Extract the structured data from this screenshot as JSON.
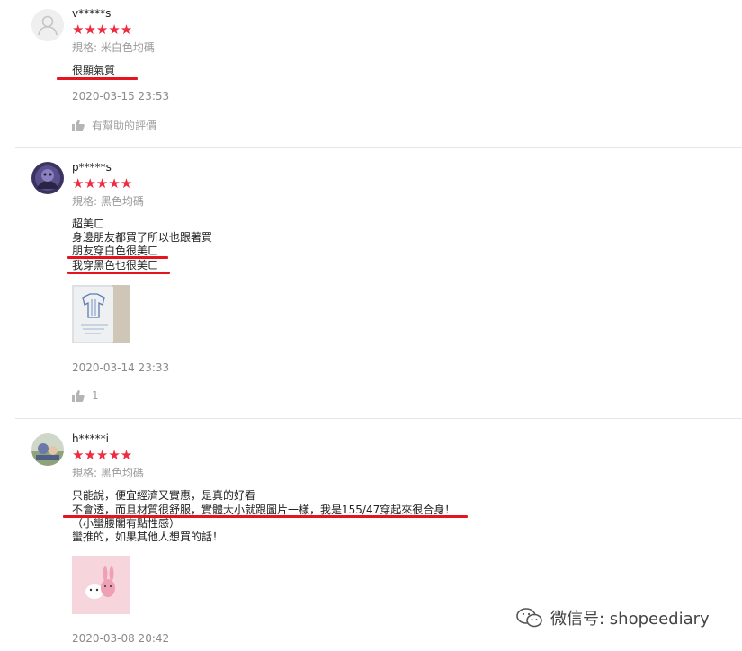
{
  "reviews": [
    {
      "username": "v*****s",
      "rating_stars": "★★★★★",
      "rating": 5,
      "variation": "規格: 米白色均碼",
      "text_lines": [
        "很顯氣質"
      ],
      "date": "2020-03-15 23:53",
      "helpful_label": "有幫助的評價",
      "avatar_icon": "default-user-avatar"
    },
    {
      "username": "p*****s",
      "rating_stars": "★★★★★",
      "rating": 5,
      "variation": "規格: 黑色均碼",
      "text_lines": [
        "超美ㄈ",
        "身邊朋友都買了所以也跟著買",
        "朋友穿白色很美ㄈ",
        "我穿黑色也很美ㄈ"
      ],
      "date": "2020-03-14 23:33",
      "helpful_count": "1"
    },
    {
      "username": "h*****i",
      "rating_stars": "★★★★★",
      "rating": 5,
      "variation": "規格: 黑色均碼",
      "text_lines": [
        "只能說，便宜經濟又實惠，是真的好看",
        "不會透，而且材質很舒服，實體大小就跟圖片一樣，我是155/47穿起來很合身！",
        "（小蠻腰閣有點性感）",
        "蠻推的，如果其他人想買的話！"
      ],
      "date": "2020-03-08 20:42"
    }
  ],
  "watermark": {
    "text": "微信号: shopeediary",
    "icon": "wechat-icon"
  },
  "colors": {
    "star": "#ee2b40",
    "highlight": "#e8141d",
    "muted": "#9a9a9a"
  }
}
